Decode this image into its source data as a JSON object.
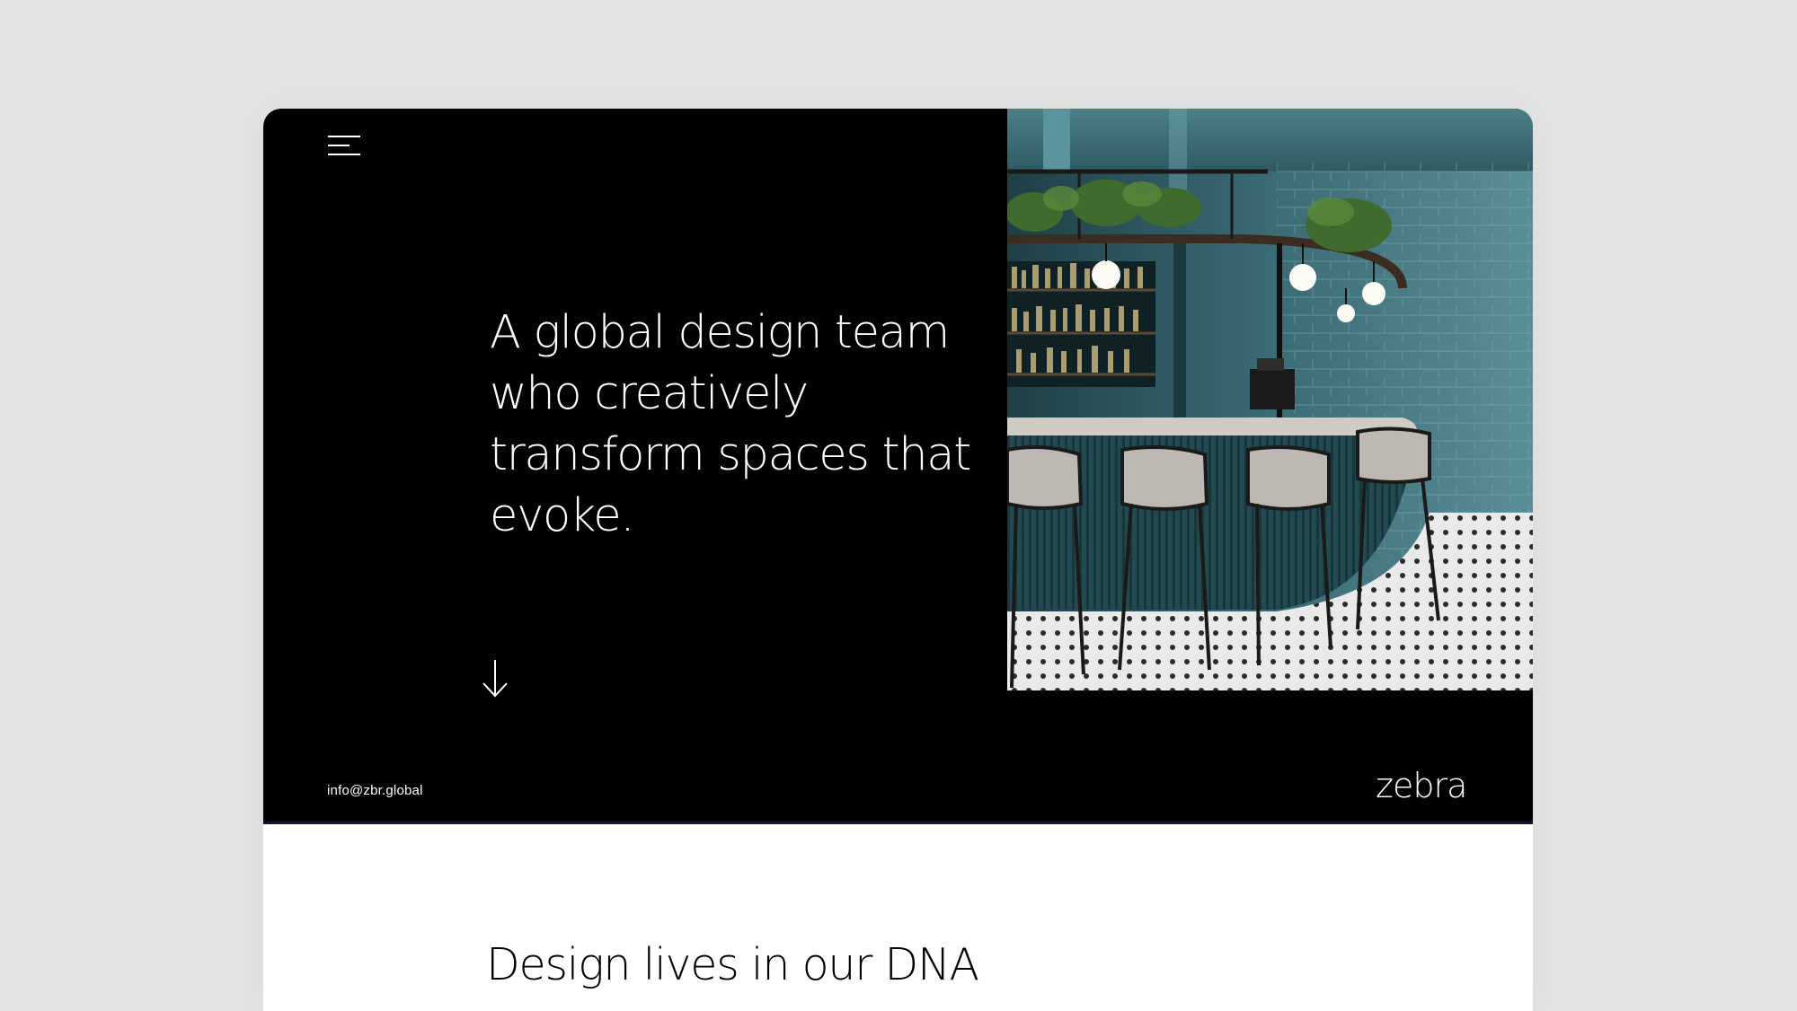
{
  "hero": {
    "headline": "A global design team who creatively transform spaces that evoke.",
    "email": "info@zbr.global",
    "logo_text": "zebra",
    "image_alt": "Bar interior with teal walls and grey bar stools"
  },
  "menu": {
    "icon": "hamburger-menu-icon"
  },
  "scroll": {
    "icon": "arrow-down-icon"
  },
  "section": {
    "title": "Design lives in our DNA"
  },
  "colors": {
    "background": "#e4e4e5",
    "hero_bg": "#000000",
    "text_on_dark": "#ffffff",
    "accent_teal": "#3d6f78"
  }
}
